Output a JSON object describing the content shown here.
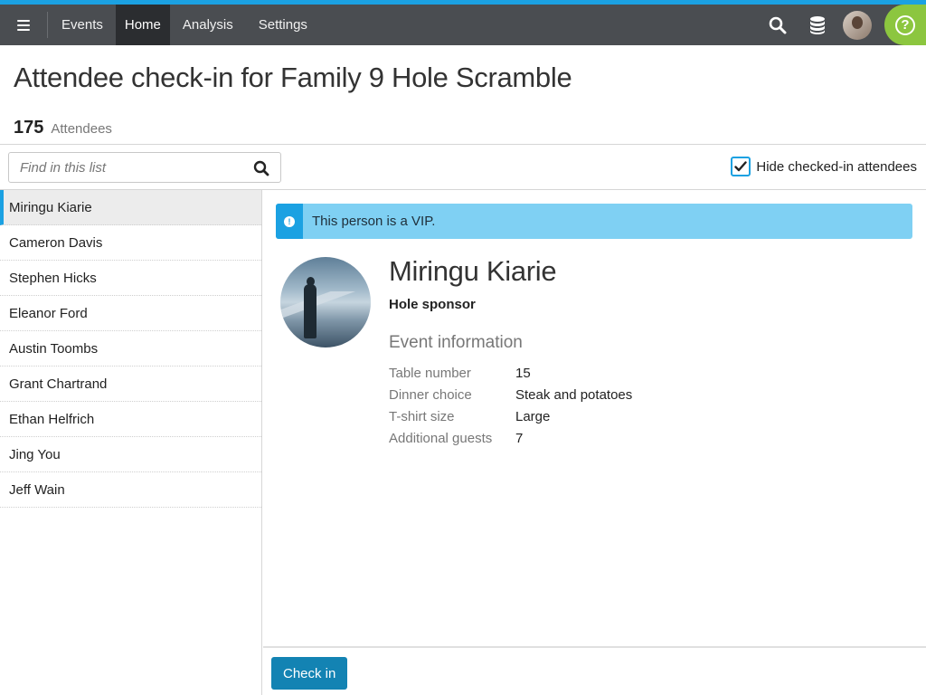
{
  "nav": {
    "menu_icon": "hamburger-icon",
    "links": [
      {
        "label": "Events"
      },
      {
        "label": "Home",
        "active": true
      },
      {
        "label": "Analysis"
      },
      {
        "label": "Settings"
      }
    ],
    "icons": [
      "search-icon",
      "database-icon",
      "avatar",
      "help-icon"
    ],
    "help_glyph": "?",
    "accent_color": "#1ba1e2",
    "help_color": "#8cc63f"
  },
  "page": {
    "title": "Attendee check-in for Family 9 Hole Scramble",
    "count": "175",
    "count_label": "Attendees"
  },
  "toolbar": {
    "search_placeholder": "Find in this list",
    "hide_checked_label": "Hide checked-in attendees",
    "hide_checked": true
  },
  "attendees": [
    "Miringu Kiarie",
    "Cameron Davis",
    "Stephen Hicks",
    "Eleanor Ford",
    "Austin Toombs",
    "Grant Chartrand",
    "Ethan Helfrich",
    "Jing You",
    "Jeff Wain"
  ],
  "detail": {
    "vip_message": "This person is a VIP.",
    "name": "Miringu Kiarie",
    "role": "Hole sponsor",
    "section_title": "Event information",
    "fields": [
      {
        "label": "Table number",
        "value": "15"
      },
      {
        "label": "Dinner choice",
        "value": "Steak and potatoes"
      },
      {
        "label": "T-shirt size",
        "value": "Large"
      },
      {
        "label": "Additional guests",
        "value": "7"
      }
    ]
  },
  "footer": {
    "checkin_label": "Check in"
  }
}
